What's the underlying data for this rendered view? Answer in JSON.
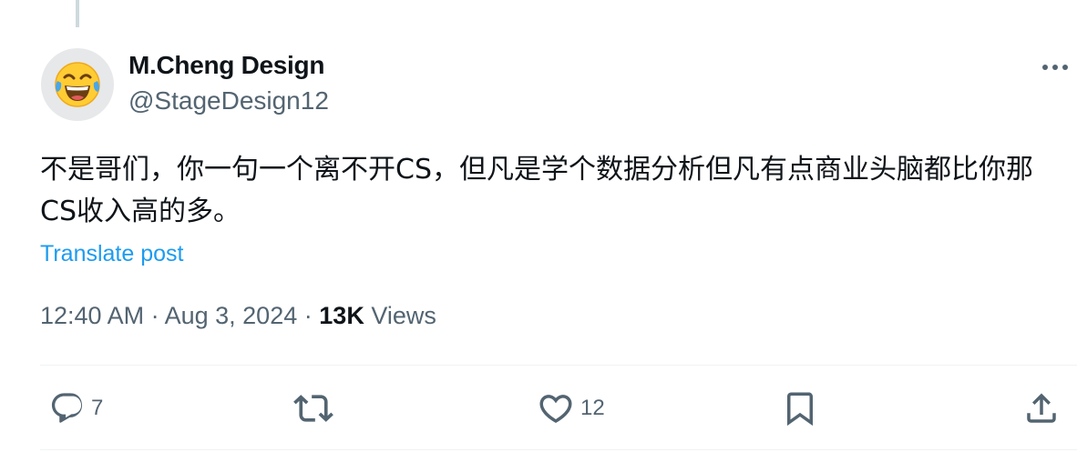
{
  "post": {
    "author": {
      "display_name": "M.Cheng Design",
      "handle": "@StageDesign12",
      "avatar_icon": "laughing-crying-emoji-icon",
      "avatar_emoji": "😂"
    },
    "text": "不是哥们，你一句一个离不开CS，但凡是学个数据分析但凡有点商业头脑都比你那CS收入高的多。",
    "translate_label": "Translate post",
    "time": "12:40 AM",
    "separator": "·",
    "date": "Aug 3, 2024",
    "views_count": "13K",
    "views_label": "Views"
  },
  "actions": {
    "reply": {
      "icon": "reply-icon",
      "count": "7"
    },
    "repost": {
      "icon": "repost-icon",
      "count": ""
    },
    "like": {
      "icon": "heart-icon",
      "count": "12"
    },
    "bookmark": {
      "icon": "bookmark-icon"
    },
    "share": {
      "icon": "share-icon"
    }
  },
  "colors": {
    "text_primary": "#0f1419",
    "text_secondary": "#536471",
    "link": "#1d9bf0",
    "divider": "#eff3f4",
    "thread_line": "#cfd9de"
  }
}
